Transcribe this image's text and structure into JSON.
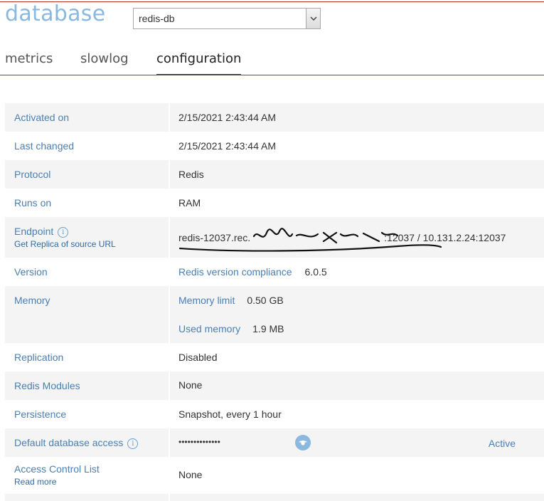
{
  "header": {
    "title": "database",
    "database_select": {
      "selected": "redis-db"
    }
  },
  "tabs": [
    {
      "label": "metrics",
      "active": false
    },
    {
      "label": "slowlog",
      "active": false
    },
    {
      "label": "configuration",
      "active": true
    }
  ],
  "config": {
    "activated_on": {
      "label": "Activated on",
      "value": "2/15/2021 2:43:44 AM"
    },
    "last_changed": {
      "label": "Last changed",
      "value": "2/15/2021 2:43:44 AM"
    },
    "protocol": {
      "label": "Protocol",
      "value": "Redis"
    },
    "runs_on": {
      "label": "Runs on",
      "value": "RAM"
    },
    "endpoint": {
      "label": "Endpoint",
      "replica_link": "Get Replica of source URL",
      "value_prefix": "redis-12037.rec.",
      "value_suffix": ":12037 / 10.131.2.24:12037"
    },
    "version": {
      "label": "Version",
      "sub_label": "Redis version compliance",
      "value": "6.0.5"
    },
    "memory": {
      "label": "Memory",
      "limit_label": "Memory limit",
      "limit_value": "0.50 GB",
      "used_label": "Used memory",
      "used_value": "1.9 MB"
    },
    "replication": {
      "label": "Replication",
      "value": "Disabled"
    },
    "modules": {
      "label": "Redis Modules",
      "value": "None"
    },
    "persistence": {
      "label": "Persistence",
      "value": "Snapshot, every 1 hour"
    },
    "default_access": {
      "label": "Default database access",
      "password_mask": "••••••••••••••",
      "status": "Active"
    },
    "acl": {
      "label": "Access Control List",
      "read_more": "Read more",
      "value": "None"
    }
  },
  "icons": {
    "info": "info-icon",
    "dropdown": "chevron-down-icon",
    "reveal": "eye-icon"
  },
  "colors": {
    "accent_line": "#b9302c",
    "title": "#8bb8df",
    "label": "#4a7fb4",
    "row_shade": "#f4f4f4"
  }
}
